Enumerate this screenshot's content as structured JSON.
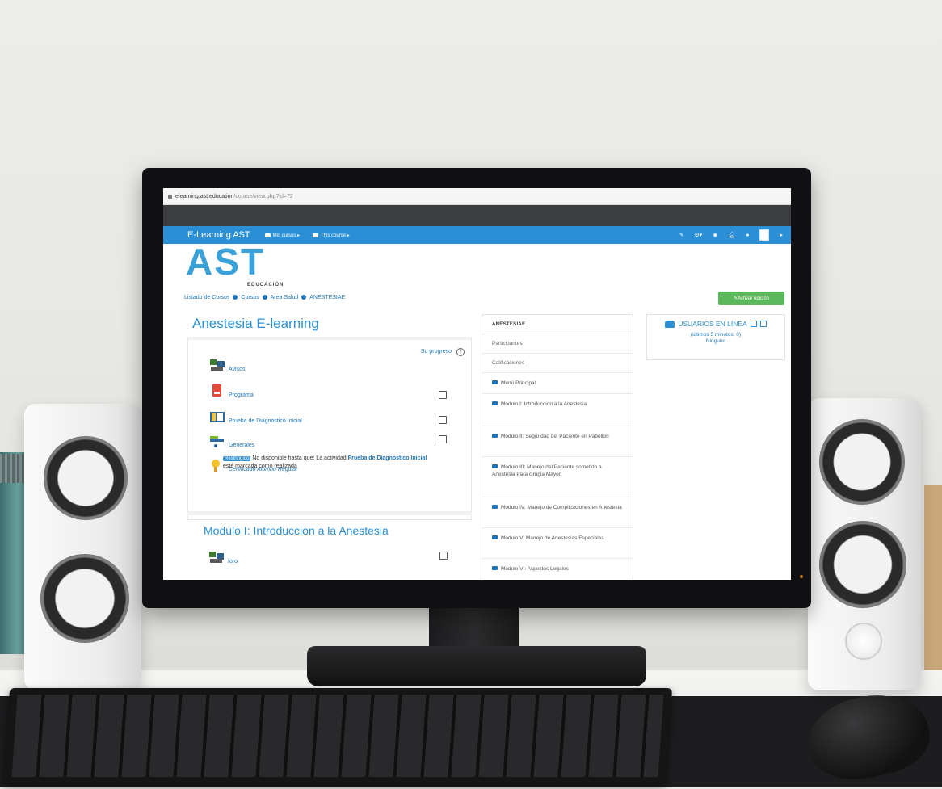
{
  "browser": {
    "url_domain": "elearning.ast.education",
    "url_path": "/course/view.php?id=72"
  },
  "navbar": {
    "brand": "E-Learning AST",
    "menu_my_courses": "Mis cursos ▸",
    "menu_this_course": "This course ▸"
  },
  "header": {
    "logo_text": "AST",
    "logo_subtitle": "EDUCACIÓN"
  },
  "breadcrumb": [
    "Listado de Cursos",
    "Cursos",
    "Area Salud",
    "ANESTESIAE"
  ],
  "edit_button_label": "Activar edición",
  "course": {
    "title": "Anestesia E-learning",
    "progress_label": "Su progreso",
    "activities": [
      {
        "label": "Avisos",
        "icon": "forum-icon",
        "has_checkbox": false
      },
      {
        "label": "Programa",
        "icon": "pdf-icon",
        "has_checkbox": true
      },
      {
        "label": "Prueba de Diagnostico Inicial",
        "icon": "quiz-icon",
        "has_checkbox": true
      },
      {
        "label": "Generales",
        "icon": "glossary-icon",
        "has_checkbox": true
      },
      {
        "label": "Certificado Alumno Regular",
        "icon": "certificate-icon",
        "has_checkbox": false
      }
    ],
    "restriction": {
      "badge": "Restringido",
      "text_before": "No disponible hasta que: La actividad",
      "activity": "Prueba de Diagnostico Inicial",
      "text_after": "esté marcada como realizada"
    },
    "module_title": "Modulo I: Introduccion a la Anestesia",
    "module_first_activity": "foro"
  },
  "course_nav": {
    "header": "ANESTESIAE",
    "participants": "Participantes",
    "grades": "Calificaciones",
    "modules": [
      "Menú Principal",
      "Modulo I: Introduccion a la Anestesia",
      "Modulo II: Seguridad del Paciente en Pabellon",
      "Modulo III: Manejo del Paciente sometido a Anestesia Para cirugia Mayor",
      "Modulo IV: Manejo de Complicaciones en Anestesia",
      "Modulo V: Manejo de Anestesias Especiales",
      "Modulo VI: Aspectos Legales"
    ]
  },
  "online_users": {
    "title": "USUARIOS EN LÍNEA",
    "subtitle": "(últimos 5 minutos: 0)",
    "empty": "Ninguno"
  },
  "colors": {
    "navbar": "#2a8fd4",
    "link": "#1e74b8",
    "edit_button": "#5cb85c",
    "logo": "#3aa0d8"
  }
}
